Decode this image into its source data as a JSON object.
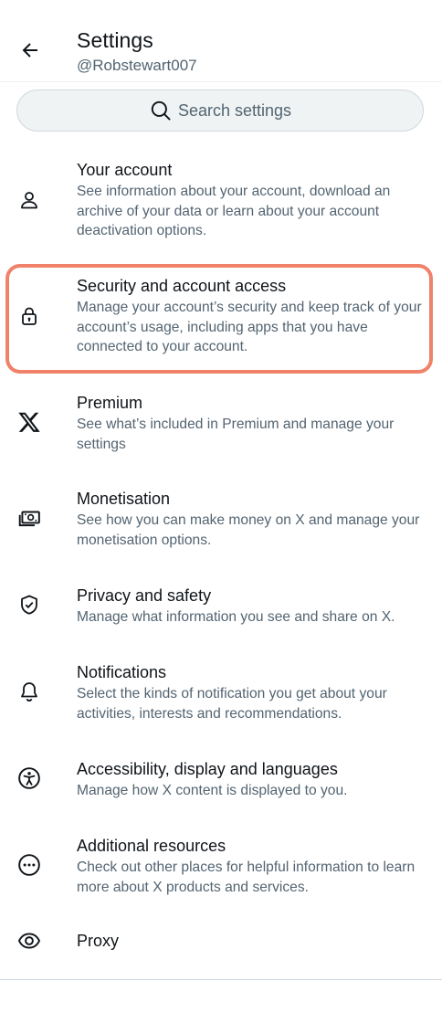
{
  "header": {
    "title": "Settings",
    "handle": "@Robstewart007"
  },
  "search": {
    "placeholder": "Search settings"
  },
  "items": [
    {
      "label": "Your account",
      "description": "See information about your account, download an archive of your data or learn about your account deactivation options.",
      "icon": "person-icon"
    },
    {
      "label": "Security and account access",
      "description": "Manage your account’s security and keep track of your account’s usage, including apps that you have connected to your account.",
      "icon": "lock-icon",
      "highlighted": true
    },
    {
      "label": "Premium",
      "description": "See what’s included in Premium and manage your settings",
      "icon": "x-logo-icon"
    },
    {
      "label": "Monetisation",
      "description": "See how you can make money on X and manage your monetisation options.",
      "icon": "money-icon"
    },
    {
      "label": "Privacy and safety",
      "description": "Manage what information you see and share on X.",
      "icon": "shield-check-icon"
    },
    {
      "label": "Notifications",
      "description": "Select the kinds of notification you get about your activities, interests and recommendations.",
      "icon": "bell-icon"
    },
    {
      "label": "Accessibility, display and languages",
      "description": "Manage how X content is displayed to you.",
      "icon": "accessibility-icon"
    },
    {
      "label": "Additional resources",
      "description": "Check out other places for helpful information to learn more about X products and services.",
      "icon": "more-circle-icon"
    },
    {
      "label": "Proxy",
      "icon": "eye-icon"
    }
  ],
  "colors": {
    "highlight": "#f0826a",
    "text": "#0f1419",
    "secondary": "#536471",
    "search_bg": "#eff3f4"
  }
}
